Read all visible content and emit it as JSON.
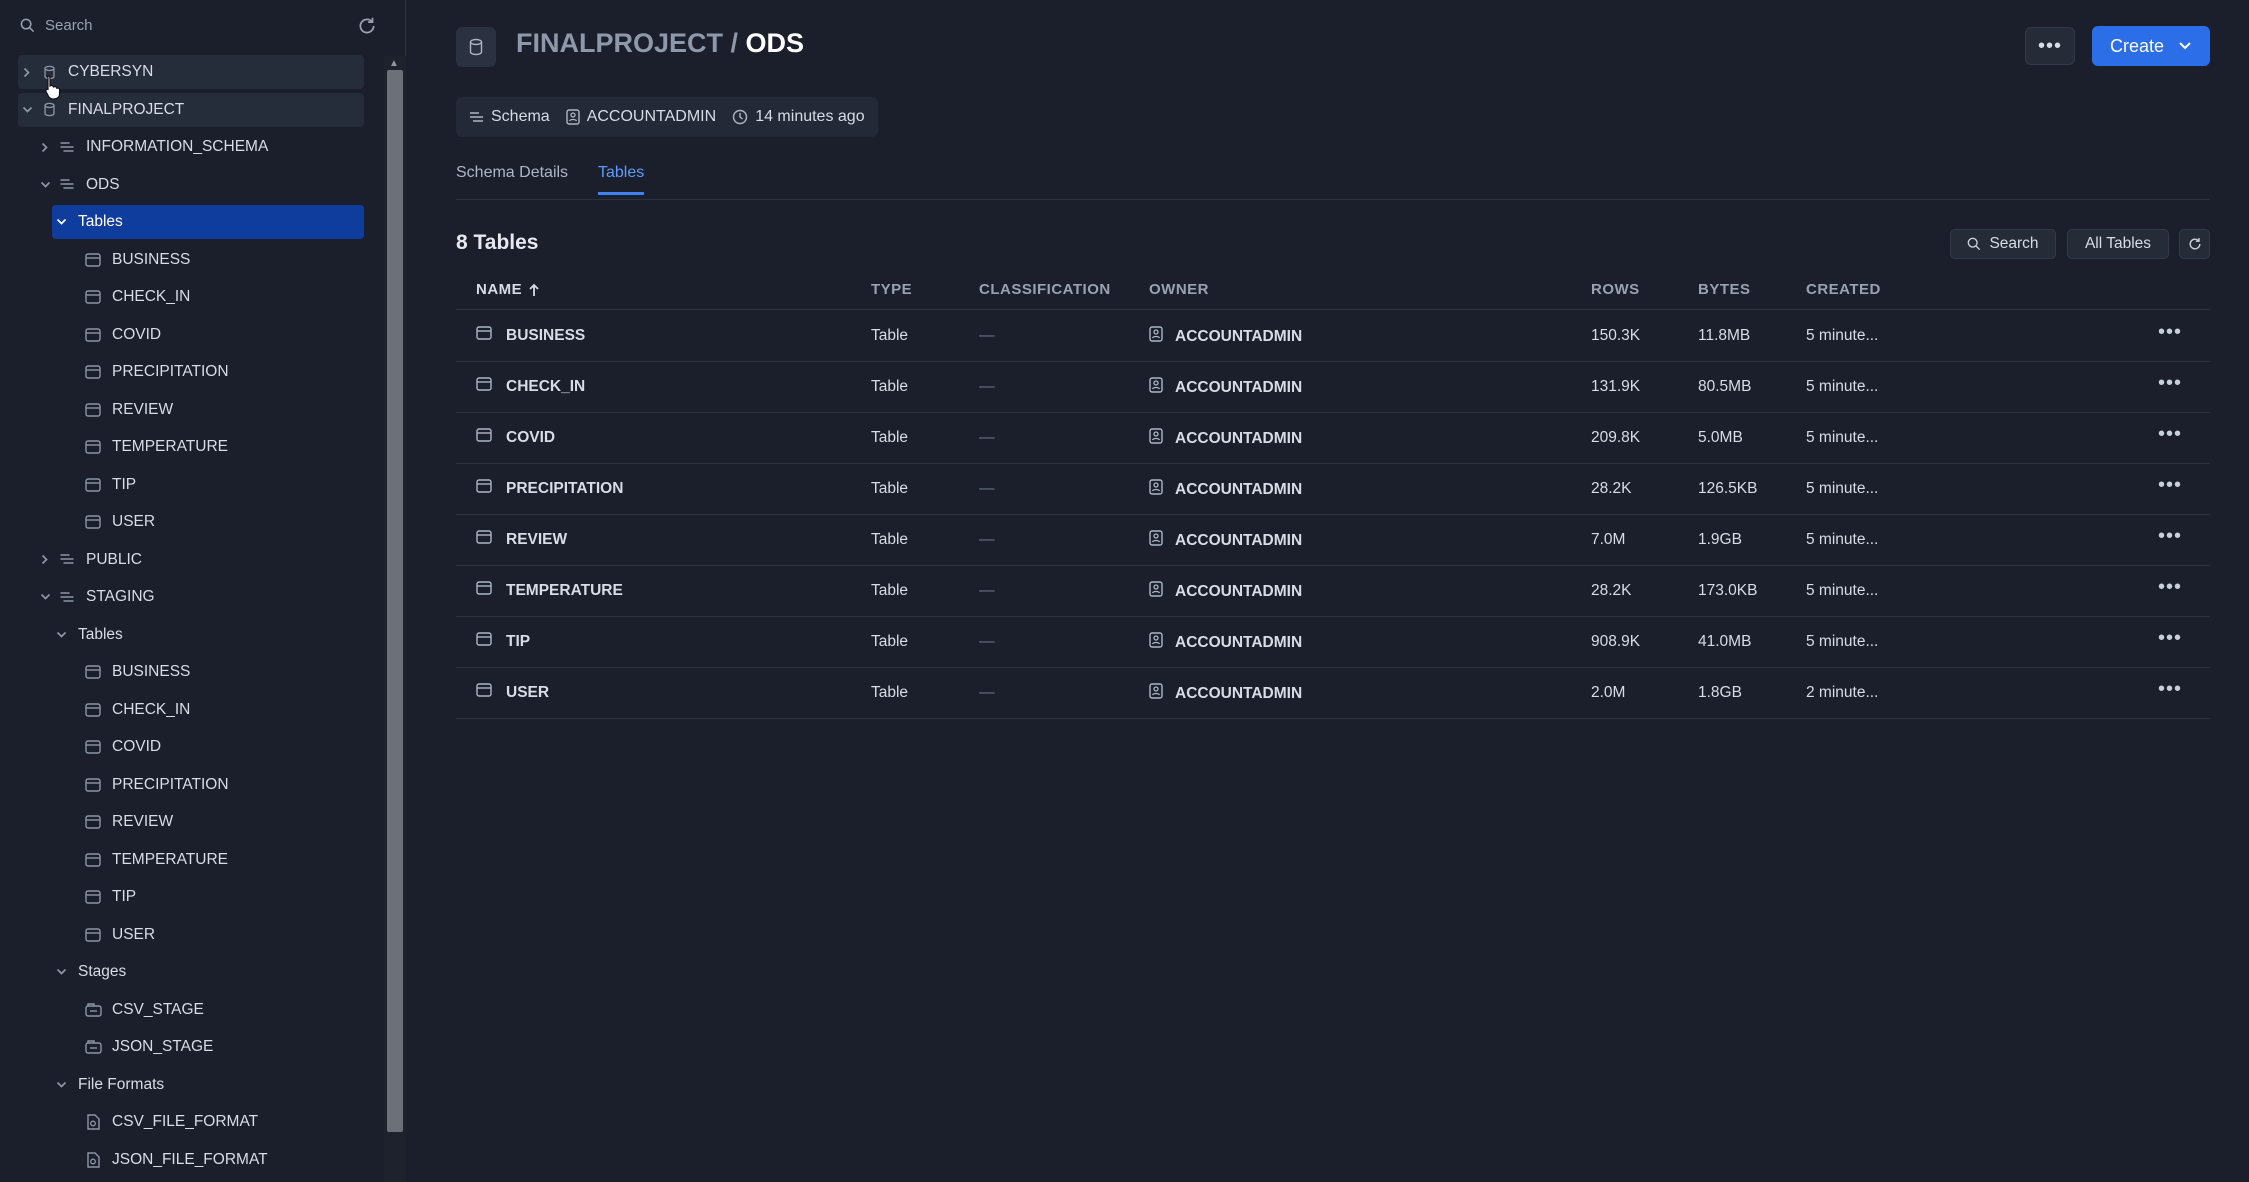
{
  "sidebar": {
    "search_placeholder": "Search",
    "tree": [
      {
        "label": "CYBERSYN",
        "icon": "database-icon",
        "expanded": false
      },
      {
        "label": "FINALPROJECT",
        "icon": "database-icon",
        "expanded": true
      },
      {
        "label": "INFORMATION_SCHEMA",
        "icon": "schema-icon",
        "expanded": false
      },
      {
        "label": "ODS",
        "icon": "schema-icon",
        "expanded": true
      },
      {
        "label": "Tables",
        "selected": true,
        "expanded": true
      },
      {
        "label": "BUSINESS",
        "icon": "table-icon"
      },
      {
        "label": "CHECK_IN",
        "icon": "table-icon"
      },
      {
        "label": "COVID",
        "icon": "table-icon"
      },
      {
        "label": "PRECIPITATION",
        "icon": "table-icon"
      },
      {
        "label": "REVIEW",
        "icon": "table-icon"
      },
      {
        "label": "TEMPERATURE",
        "icon": "table-icon"
      },
      {
        "label": "TIP",
        "icon": "table-icon"
      },
      {
        "label": "USER",
        "icon": "table-icon"
      },
      {
        "label": "PUBLIC",
        "icon": "schema-icon",
        "expanded": false
      },
      {
        "label": "STAGING",
        "icon": "schema-icon",
        "expanded": true
      },
      {
        "label": "Tables",
        "expanded": true
      },
      {
        "label": "BUSINESS",
        "icon": "table-icon"
      },
      {
        "label": "CHECK_IN",
        "icon": "table-icon"
      },
      {
        "label": "COVID",
        "icon": "table-icon"
      },
      {
        "label": "PRECIPITATION",
        "icon": "table-icon"
      },
      {
        "label": "REVIEW",
        "icon": "table-icon"
      },
      {
        "label": "TEMPERATURE",
        "icon": "table-icon"
      },
      {
        "label": "TIP",
        "icon": "table-icon"
      },
      {
        "label": "USER",
        "icon": "table-icon"
      },
      {
        "label": "Stages",
        "expanded": true
      },
      {
        "label": "CSV_STAGE",
        "icon": "stage-icon"
      },
      {
        "label": "JSON_STAGE",
        "icon": "stage-icon"
      },
      {
        "label": "File Formats",
        "expanded": true
      },
      {
        "label": "CSV_FILE_FORMAT",
        "icon": "file-format-icon"
      },
      {
        "label": "JSON_FILE_FORMAT",
        "icon": "file-format-icon"
      }
    ]
  },
  "header": {
    "parent": "FINALPROJECT",
    "separator": " / ",
    "current": "ODS",
    "create_label": "Create"
  },
  "meta": {
    "type": "Schema",
    "owner": "ACCOUNTADMIN",
    "updated": "14 minutes ago"
  },
  "tabs": [
    {
      "label": "Schema Details",
      "active": false
    },
    {
      "label": "Tables",
      "active": true
    }
  ],
  "table_section": {
    "count_title": "8 Tables",
    "search_label": "Search",
    "filter_label": "All Tables"
  },
  "columns": [
    "NAME",
    "TYPE",
    "CLASSIFICATION",
    "OWNER",
    "ROWS",
    "BYTES",
    "CREATED"
  ],
  "rows": [
    {
      "name": "BUSINESS",
      "type": "Table",
      "classification": "—",
      "owner": "ACCOUNTADMIN",
      "rows": "150.3K",
      "bytes": "11.8MB",
      "created": "5 minute..."
    },
    {
      "name": "CHECK_IN",
      "type": "Table",
      "classification": "—",
      "owner": "ACCOUNTADMIN",
      "rows": "131.9K",
      "bytes": "80.5MB",
      "created": "5 minute..."
    },
    {
      "name": "COVID",
      "type": "Table",
      "classification": "—",
      "owner": "ACCOUNTADMIN",
      "rows": "209.8K",
      "bytes": "5.0MB",
      "created": "5 minute..."
    },
    {
      "name": "PRECIPITATION",
      "type": "Table",
      "classification": "—",
      "owner": "ACCOUNTADMIN",
      "rows": "28.2K",
      "bytes": "126.5KB",
      "created": "5 minute..."
    },
    {
      "name": "REVIEW",
      "type": "Table",
      "classification": "—",
      "owner": "ACCOUNTADMIN",
      "rows": "7.0M",
      "bytes": "1.9GB",
      "created": "5 minute..."
    },
    {
      "name": "TEMPERATURE",
      "type": "Table",
      "classification": "—",
      "owner": "ACCOUNTADMIN",
      "rows": "28.2K",
      "bytes": "173.0KB",
      "created": "5 minute..."
    },
    {
      "name": "TIP",
      "type": "Table",
      "classification": "—",
      "owner": "ACCOUNTADMIN",
      "rows": "908.9K",
      "bytes": "41.0MB",
      "created": "5 minute..."
    },
    {
      "name": "USER",
      "type": "Table",
      "classification": "—",
      "owner": "ACCOUNTADMIN",
      "rows": "2.0M",
      "bytes": "1.8GB",
      "created": "2 minute..."
    }
  ],
  "colors": {
    "background": "#1a1f2b",
    "accent": "#2c6ee8",
    "selected": "#0f3d9e",
    "tab_active": "#5f9bff"
  }
}
